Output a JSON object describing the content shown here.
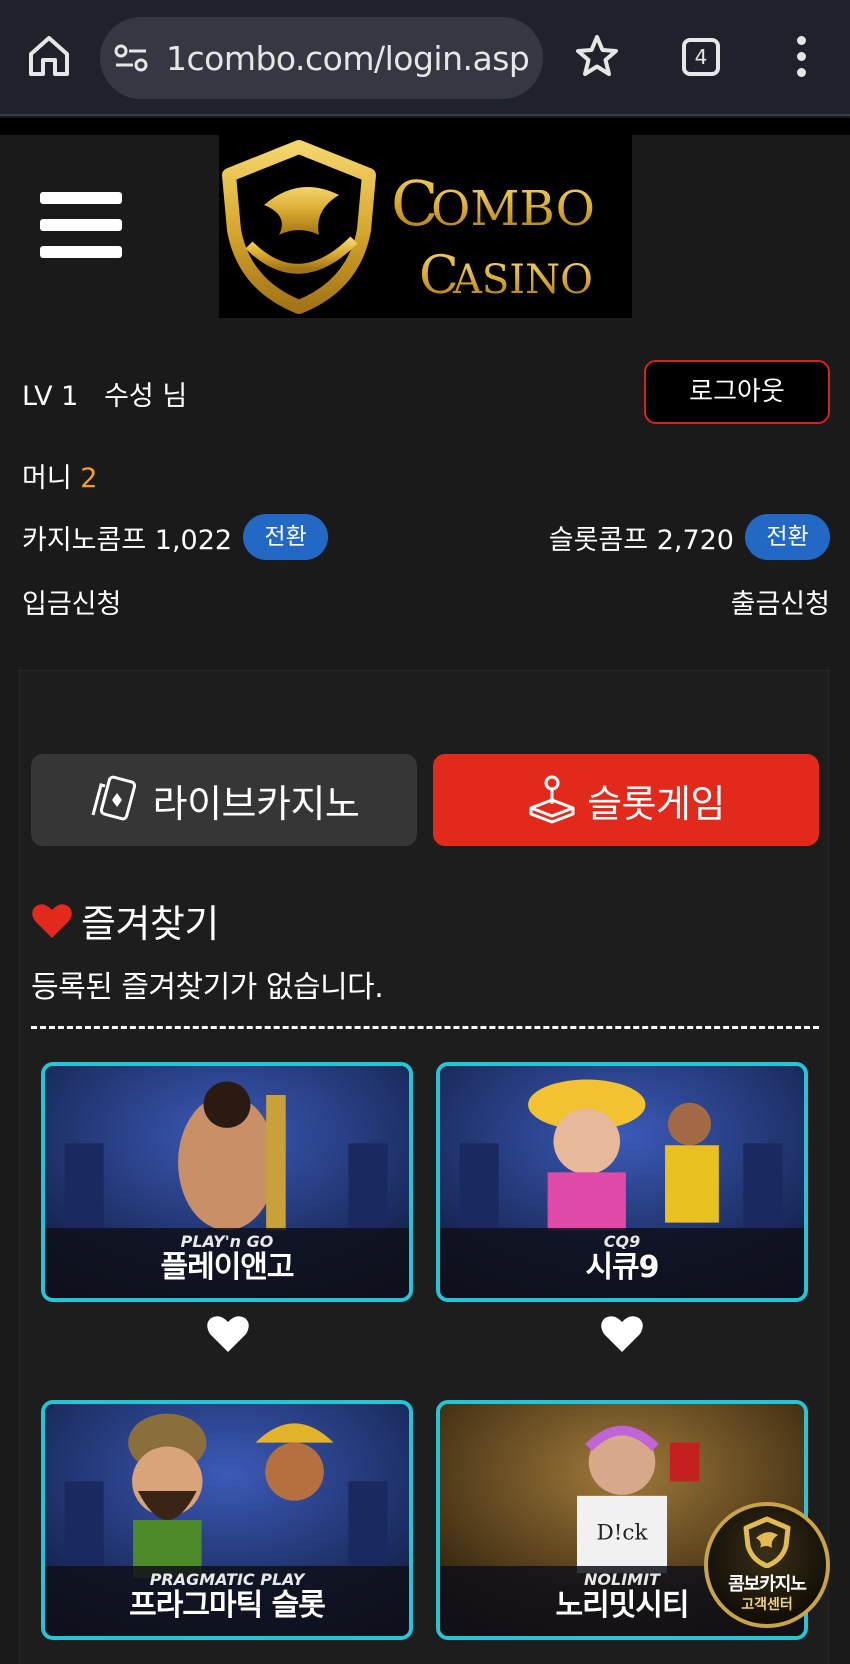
{
  "browser": {
    "url": "1combo.com/login.asp",
    "tab_count": "4"
  },
  "header": {
    "logo_alt": "COMBO CASINO"
  },
  "user": {
    "level": "LV 1",
    "name": "수성 님",
    "logout_label": "로그아웃",
    "money_label": "머니",
    "money_value": "2",
    "casino_comp_label": "카지노콤프 1,022",
    "slot_comp_label": "슬롯콤프 2,720",
    "convert_label": "전환",
    "deposit_label": "입금신청",
    "withdraw_label": "출금신청"
  },
  "tabs": {
    "live_casino": "라이브카지노",
    "slot_game": "슬롯게임"
  },
  "favorites": {
    "title": "즐겨찾기",
    "empty_message": "등록된 즐겨찾기가 없습니다."
  },
  "games": [
    {
      "brand": "PLAY'n GO",
      "name": "플레이앤고"
    },
    {
      "brand": "CQ9",
      "name": "시큐9"
    },
    {
      "brand": "PRAGMATIC PLAY",
      "name": "프라그마틱 슬롯"
    },
    {
      "brand": "NOLIMIT",
      "name": "노리밋시티"
    }
  ],
  "cs_badge": {
    "line1": "콤보카지노",
    "line2": "고객센터"
  },
  "colors": {
    "accent_red": "#e12a1b",
    "convert_blue": "#2268c4",
    "money_orange": "#f4a12a",
    "card_border": "#24c6d6",
    "logo_gold": "#d9b23c"
  }
}
